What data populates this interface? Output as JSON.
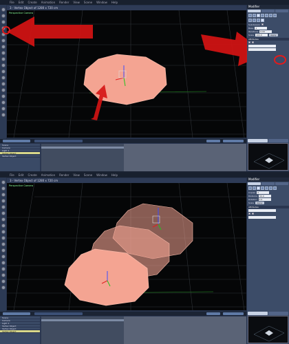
{
  "menu": [
    "File",
    "Edit",
    "Create",
    "Animation",
    "Render",
    "View",
    "Scene",
    "Window",
    "Help"
  ],
  "screens": [
    {
      "viewport_title": "3 - Vertex Object of 1280 x 720 cm",
      "viewport_label": "Perspective Camera",
      "panel_title": "Modifier",
      "panel_rows": [
        "Subdivision",
        "Base",
        "Iterations",
        "Scale"
      ],
      "panel_field_values": [
        "1",
        "0.00",
        "100.0"
      ],
      "apply_label": "Apply",
      "section_label": "Attributes",
      "timeline_rows": [
        "Scene",
        "Camera",
        "Light 1",
        "Vertex Object",
        "Vertex Object"
      ]
    },
    {
      "viewport_title": "3 - Vertex Object of 1280 x 720 cm",
      "viewport_label": "Perspective Camera",
      "panel_title": "Modifier",
      "panel_rows": [
        "Copies",
        "Distance",
        "Rotation",
        "Scale"
      ],
      "panel_field_values": [
        "2",
        "50.0",
        "0.0"
      ],
      "apply_label": "Apply",
      "section_label": "Attributes",
      "timeline_rows": [
        "Scene",
        "Camera",
        "Light 1",
        "Vertex Object",
        "Vertex Object",
        "Vertex Object"
      ]
    }
  ],
  "colors": {
    "shape_fill": "#f4a492",
    "shape_stroke": "#f7b8a8",
    "annotation": "#d51414",
    "grid": "#2f3338"
  },
  "icons": [
    "gear-icon",
    "move-icon",
    "rotate-icon",
    "scale-icon",
    "camera-icon",
    "light-icon"
  ]
}
